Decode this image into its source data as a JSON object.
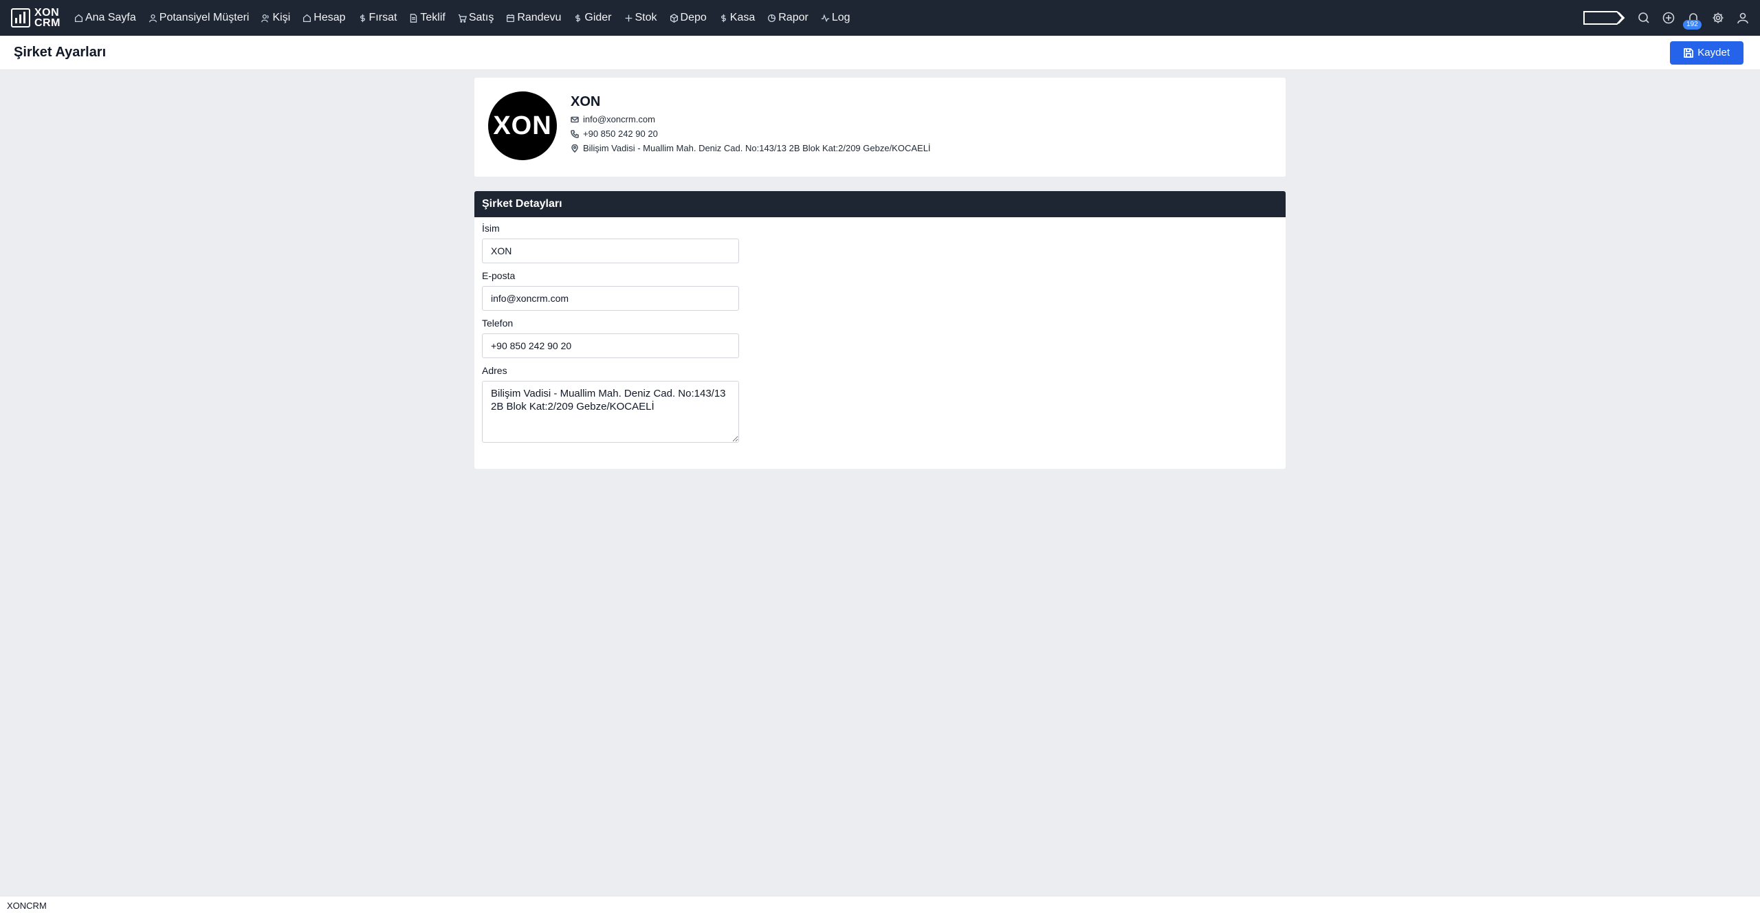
{
  "navbar": {
    "logo_top": "XON",
    "logo_bottom": "CRM",
    "items": [
      {
        "label": "Ana Sayfa",
        "icon": "home-icon"
      },
      {
        "label": "Potansiyel Müşteri",
        "icon": "user-icon"
      },
      {
        "label": "Kişi",
        "icon": "users-icon"
      },
      {
        "label": "Hesap",
        "icon": "building-icon"
      },
      {
        "label": "Fırsat",
        "icon": "dollar-icon"
      },
      {
        "label": "Teklif",
        "icon": "document-icon"
      },
      {
        "label": "Satış",
        "icon": "cart-icon"
      },
      {
        "label": "Randevu",
        "icon": "calendar-icon"
      },
      {
        "label": "Gider",
        "icon": "dollar-icon"
      },
      {
        "label": "Stok",
        "icon": "plus-icon"
      },
      {
        "label": "Depo",
        "icon": "box-icon"
      },
      {
        "label": "Kasa",
        "icon": "dollar-icon"
      },
      {
        "label": "Rapor",
        "icon": "chart-pie-icon"
      },
      {
        "label": "Log",
        "icon": "activity-icon"
      }
    ],
    "notification_count": "192"
  },
  "header": {
    "title": "Şirket Ayarları",
    "save_label": "Kaydet"
  },
  "company": {
    "avatar_text": "XON",
    "name": "XON",
    "email": "info@xoncrm.com",
    "phone": "+90 850 242 90 20",
    "address": "Bilişim Vadisi - Muallim Mah. Deniz Cad. No:143/13 2B Blok Kat:2/209 Gebze/KOCAELİ"
  },
  "details": {
    "title": "Şirket Detayları",
    "name_label": "İsim",
    "name_value": "XON",
    "email_label": "E-posta",
    "email_value": "info@xoncrm.com",
    "phone_label": "Telefon",
    "phone_value": "+90 850 242 90 20",
    "address_label": "Adres",
    "address_value": "Bilişim Vadisi - Muallim Mah. Deniz Cad. No:143/13 2B Blok Kat:2/209 Gebze/KOCAELİ"
  },
  "footer": {
    "text": "XONCRM"
  }
}
